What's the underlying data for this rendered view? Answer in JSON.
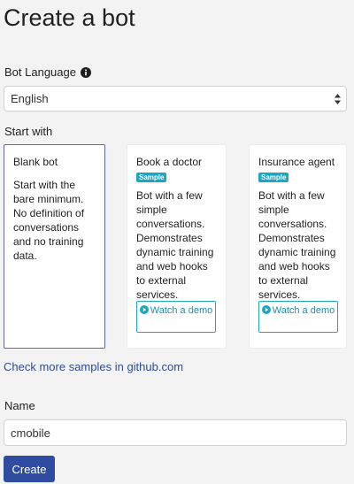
{
  "page": {
    "title": "Create a bot"
  },
  "language": {
    "label": "Bot Language",
    "info_icon": "info-circle-icon",
    "selected": "English"
  },
  "start_with": {
    "label": "Start with",
    "cards": [
      {
        "title": "Blank bot",
        "badge": "",
        "description": "Start with the bare minimum. No definition of conversations and no training data.",
        "selected": true
      },
      {
        "title": "Book a doctor",
        "badge": "Sample",
        "description": "Bot with a few simple conversations. Demonstrates dynamic training and web hooks to external services.",
        "watch_label": "Watch a demo",
        "selected": false
      },
      {
        "title": "Insurance agent",
        "badge": "Sample",
        "description": "Bot with a few simple conversations. Demonstrates dynamic training and web hooks to external services.",
        "watch_label": "Watch a demo",
        "selected": false
      }
    ]
  },
  "samples_link": "Check more samples in github.com",
  "name": {
    "label": "Name",
    "value": "cmobile"
  },
  "create_label": "Create",
  "colors": {
    "primary": "#2f4da0",
    "badge": "#1ba6c6",
    "link": "#2e4c9b",
    "selected_border": "#5a6ab7"
  }
}
